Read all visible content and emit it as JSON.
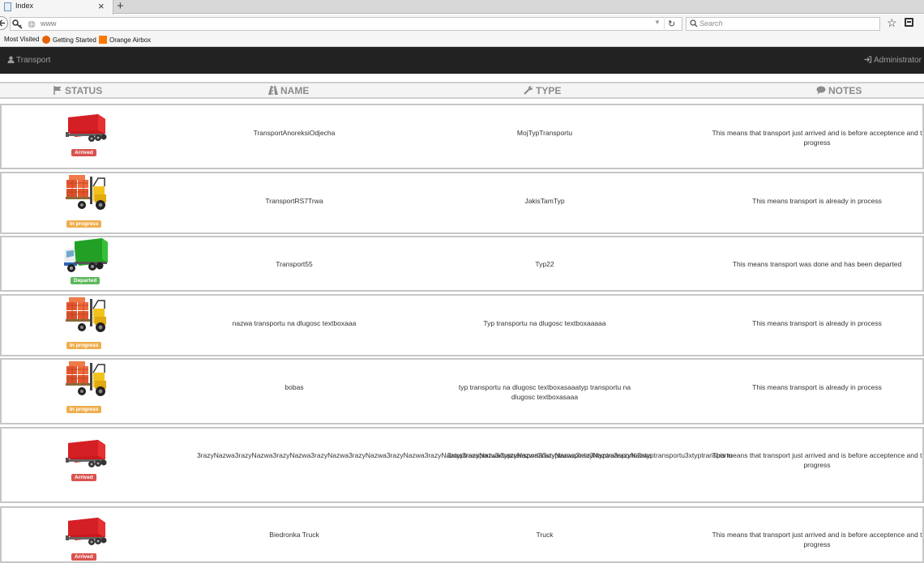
{
  "browser": {
    "tab_title": "Index",
    "tab_close": "×",
    "new_tab": "+",
    "url": "www",
    "search_placeholder": "Search",
    "bookmarks": [
      {
        "label": "Most Visited"
      },
      {
        "label": "Getting Started"
      },
      {
        "label": "Orange Airbox"
      }
    ]
  },
  "header": {
    "brand": "Transport",
    "user": "Administrator -"
  },
  "table": {
    "columns": {
      "status": "STATUS",
      "name": "NAME",
      "type": "TYPE",
      "notes": "NOTES"
    },
    "rows": [
      {
        "status": "Arrived",
        "icon": "trailer-icon",
        "name": "TransportAnoreksiOdjecha",
        "type": "MojTypTransportu",
        "notes": "This means that transport just arrived and is before acceptence and t progress"
      },
      {
        "status": "In progress",
        "icon": "forklift-icon",
        "name": "TransportRS7Trwa",
        "type": "JakisTamTyp",
        "notes": "This means transport is already in process"
      },
      {
        "status": "Departed",
        "icon": "truck-icon",
        "name": "Transport55",
        "type": "Typ22",
        "notes": "This means transport was done and has been departed"
      },
      {
        "status": "In progress",
        "icon": "forklift-icon",
        "name": "nazwa transportu na dlugosc textboxaaa",
        "type": "Typ transportu na dlugosc textboxaaaaa",
        "notes": "This means transport is already in process"
      },
      {
        "status": "In progress",
        "icon": "forklift-icon",
        "name": "bobas",
        "type": "typ transportu na dlugosc textboxasaaatyp transportu na dlugosc textboxasaaa",
        "notes": "This means transport is already in process"
      },
      {
        "status": "Arrived",
        "icon": "trailer-icon",
        "name": "3razyNazwa3razyNazwa3razyNazwa3razyNazwa3razyNazwa3razyNazwa3razyNazwa3razyNazwa3razyNazwa3razyNazwa3razyNazwa3razyNazwa",
        "type": "3xtyptransportu3xtyptransportu3xtyptransportu3xtyptransportu3xtyptransportu3xtyptransportu",
        "notes": "This means that transport just arrived and is before acceptence and t progress"
      },
      {
        "status": "Arrived",
        "icon": "trailer-icon",
        "name": "Biedronka Truck",
        "type": "Truck",
        "notes": "This means that transport just arrived and is before acceptence and t progress"
      }
    ]
  },
  "colors": {
    "arrived": "#d9534f",
    "in_progress": "#f0ad4e",
    "departed": "#5cb85c",
    "navbar": "#222222"
  }
}
